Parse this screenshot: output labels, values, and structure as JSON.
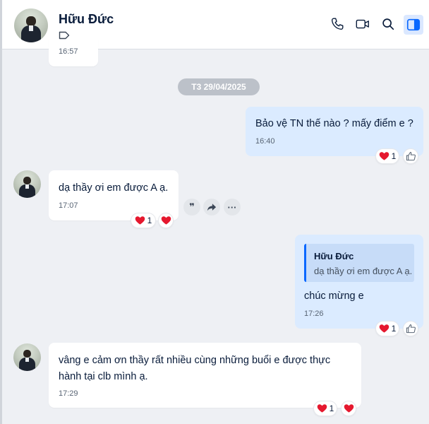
{
  "header": {
    "name": "Hữu Đức",
    "icons": [
      "avatar",
      "tag-icon",
      "phone-icon",
      "video-icon",
      "search-icon",
      "panel-toggle-icon"
    ],
    "accent_color": "#0a68ff"
  },
  "messages": {
    "prev_time": "16:57",
    "date_divider": "T3 29/04/2025",
    "m1": {
      "text": "Bảo vệ TN thế nào ? mấy điểm e ?",
      "time": "16:40",
      "reaction_count": "1"
    },
    "m2": {
      "text": "dạ thầy ơi em được A ạ.",
      "time": "17:07",
      "reaction_count": "1"
    },
    "m3": {
      "quote_name": "Hữu Đức",
      "quote_text": "dạ thầy ơi em được A ạ.",
      "text": "chúc mừng e",
      "time": "17:26",
      "reaction_count": "1"
    },
    "m4": {
      "line1": "vâng e cảm ơn thầy rất nhiều cùng những buổi e được thực",
      "line2": "hành tại clb mình ạ.",
      "time": "17:29",
      "reaction_count": "1"
    }
  },
  "actions": {
    "quote_label": "❞",
    "more_label": "···"
  }
}
